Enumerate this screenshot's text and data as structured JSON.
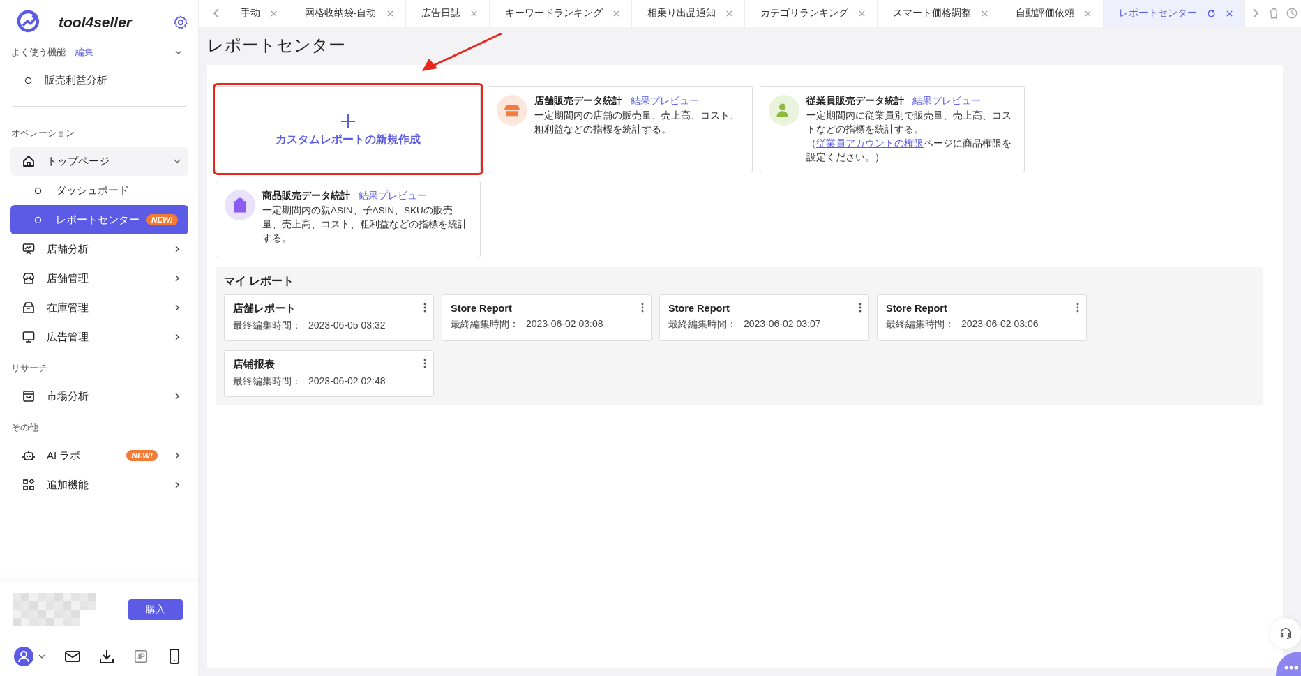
{
  "sidebar": {
    "brand": "tool4seller",
    "favorites": {
      "title": "よく使う機能",
      "edit_link": "編集",
      "expanded": true,
      "items": [
        {
          "label": "販売利益分析"
        }
      ]
    },
    "sections": [
      {
        "title": "オペレーション",
        "items": [
          {
            "label": "トップページ",
            "expanded": true,
            "children": [
              {
                "label": "ダッシュボード",
                "selected": false
              },
              {
                "label": "レポートセンター",
                "selected": true,
                "badge": "NEW!"
              }
            ]
          },
          {
            "label": "店舗分析",
            "expanded": false
          },
          {
            "label": "店舗管理",
            "expanded": false
          },
          {
            "label": "在庫管理",
            "expanded": false
          },
          {
            "label": "広告管理",
            "expanded": false
          }
        ]
      },
      {
        "title": "リサーチ",
        "items": [
          {
            "label": "市場分析",
            "expanded": false
          }
        ]
      },
      {
        "title": "その他",
        "items": [
          {
            "label": "AI ラボ",
            "expanded": false,
            "badge": "NEW!"
          },
          {
            "label": "追加機能",
            "expanded": false
          }
        ]
      }
    ],
    "buy_button": "購入"
  },
  "tabs": [
    {
      "label": "手动",
      "selected": false
    },
    {
      "label": "网格收纳袋-自动",
      "selected": false
    },
    {
      "label": "広告日誌",
      "selected": false
    },
    {
      "label": "キーワードランキング",
      "selected": false
    },
    {
      "label": "相乗り出品通知",
      "selected": false
    },
    {
      "label": "カテゴリランキング",
      "selected": false
    },
    {
      "label": "スマート価格調整",
      "selected": false
    },
    {
      "label": "自動評価依頼",
      "selected": false
    },
    {
      "label": "レポートセンター",
      "selected": true
    }
  ],
  "page": {
    "title": "レポートセンター",
    "templates": [
      {
        "kind": "create",
        "label": "カスタムレポートの新規作成",
        "highlighted": true
      },
      {
        "kind": "template",
        "title": "店舗販売データ統計",
        "preview_link": "結果プレビュー",
        "color": "#f47c3c",
        "description": "一定期間内の店舗の販売量、売上高、コスト、粗利益などの指標を統計する。"
      },
      {
        "kind": "template",
        "title": "従業員販売データ統計",
        "preview_link": "結果プレビュー",
        "color": "#8dbb3c",
        "description": "一定期間内に従業員別で販売量、売上高、コストなどの指標を統計する。（",
        "link": "従業員アカウントの権限",
        "description_end": "ページに商品権限を設定ください。）"
      },
      {
        "kind": "template",
        "title": "商品販売データ統計",
        "preview_link": "結果プレビュー",
        "color": "#8a5cf0",
        "description": "一定期間内の親ASIN、子ASIN、SKUの販売量、売上高、コスト、粗利益などの指標を統計する。"
      }
    ],
    "my_reports": {
      "title": "マイ レポート",
      "items": [
        {
          "name": "店舗レポート",
          "edited_label": "最終編集時間：",
          "edited": "2023-06-05 03:32"
        },
        {
          "name": "Store Report",
          "edited_label": "最終編集時間：",
          "edited": "2023-06-02 03:08"
        },
        {
          "name": "Store Report",
          "edited_label": "最終編集時間：",
          "edited": "2023-06-02 03:07"
        },
        {
          "name": "Store Report",
          "edited_label": "最終編集時間：",
          "edited": "2023-06-02 03:06"
        },
        {
          "name": "店铺报表",
          "edited_label": "最終編集時間：",
          "edited": "2023-06-02 02:48"
        }
      ]
    }
  }
}
